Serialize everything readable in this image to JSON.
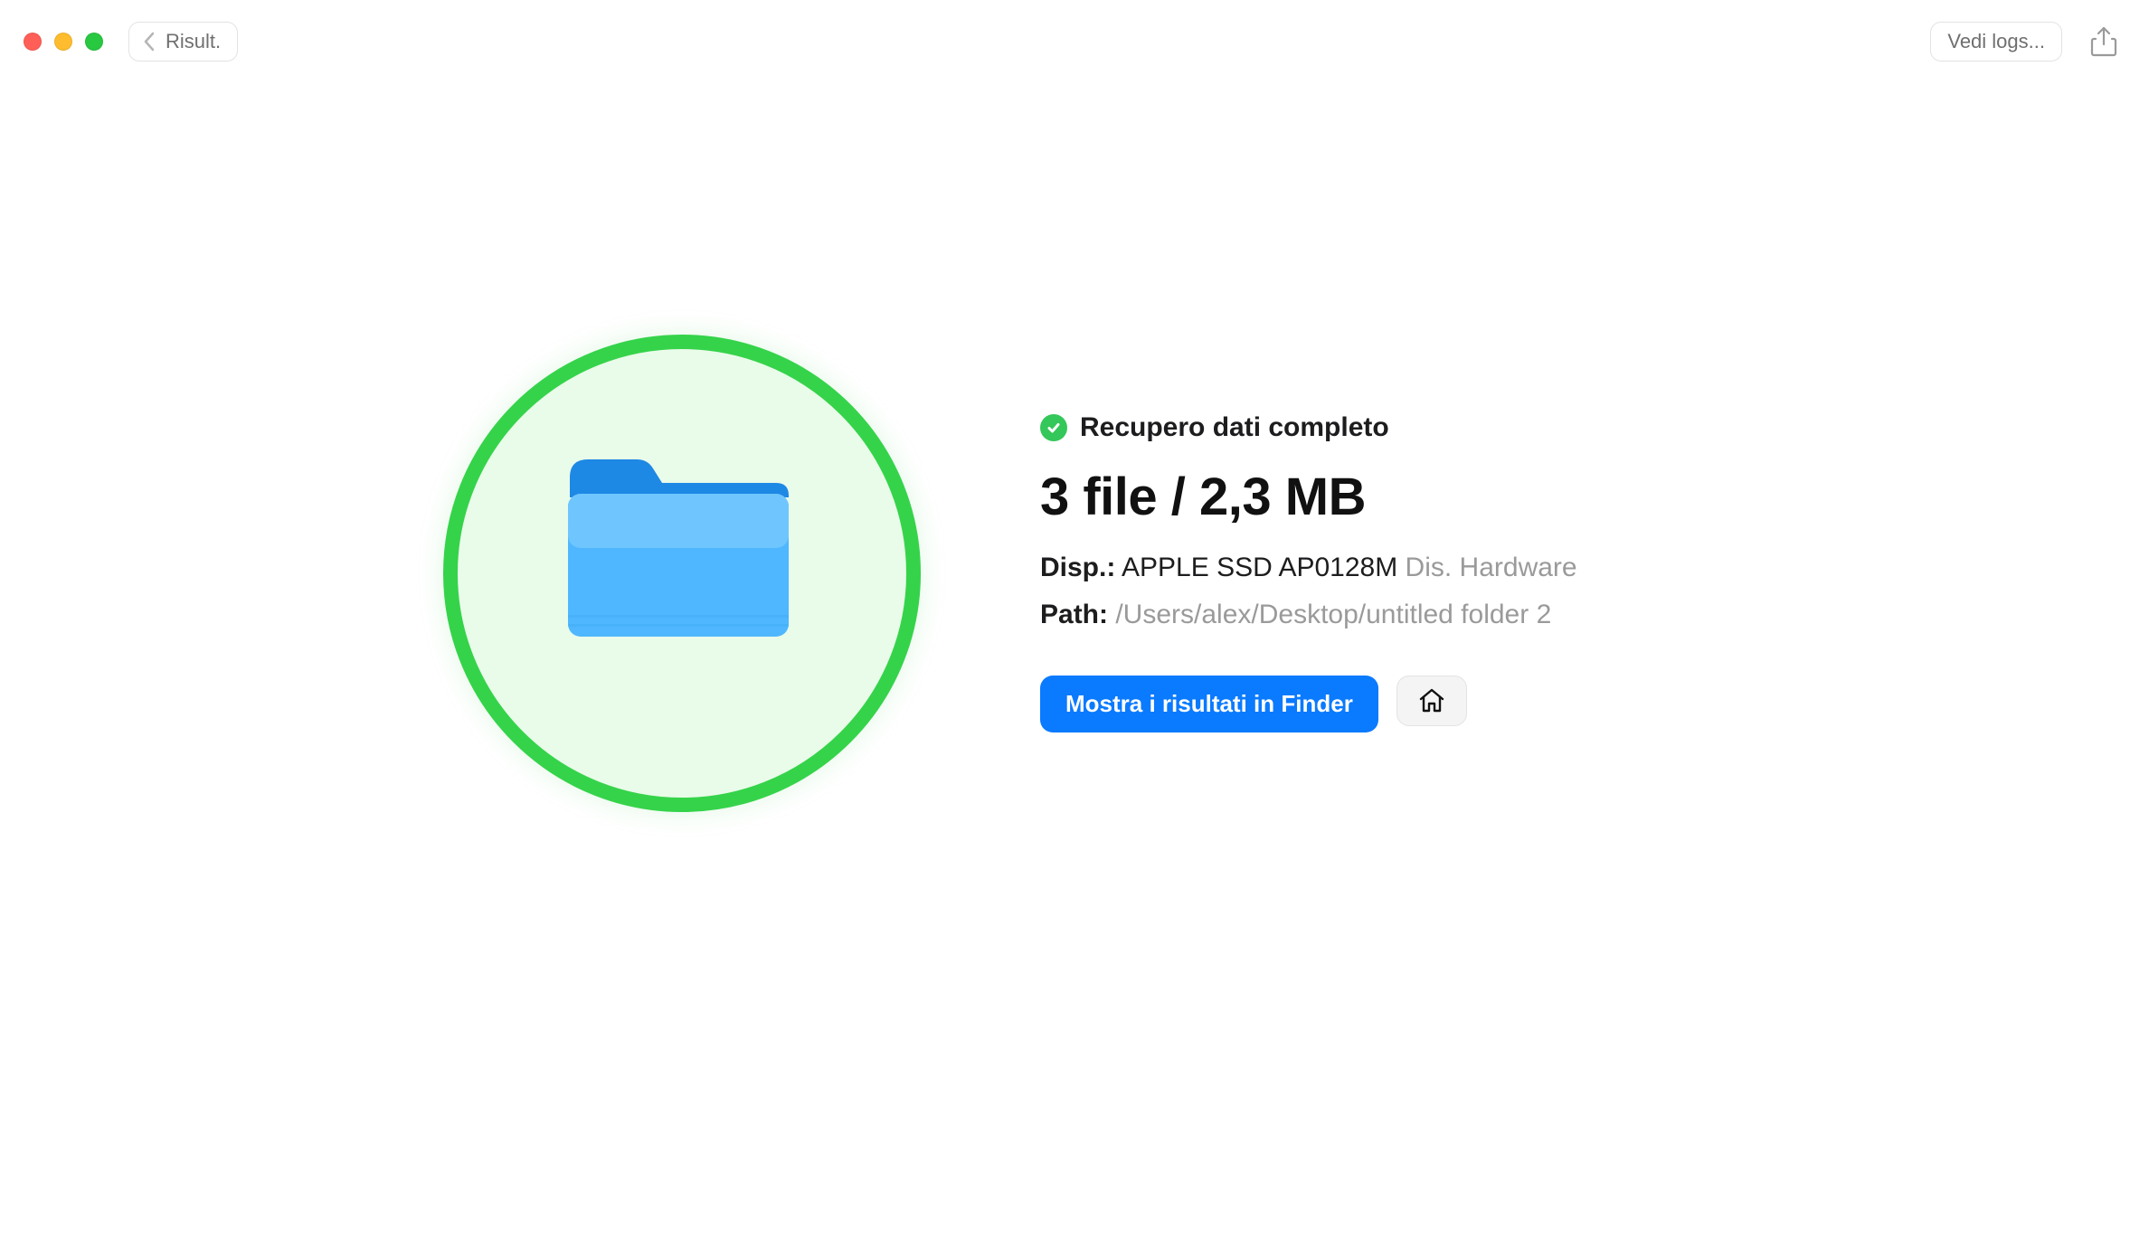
{
  "toolbar": {
    "back_label": "Risult.",
    "logs_label": "Vedi logs..."
  },
  "status": {
    "title": "Recupero dati completo",
    "file_count_text": "3 file",
    "file_size_text": "2,3 MB"
  },
  "details": {
    "device_label": "Disp.:",
    "device_value": "APPLE SSD AP0128M",
    "device_suffix": "Dis. Hardware",
    "path_label": "Path:",
    "path_value": "/Users/alex/Desktop/untitled folder 2"
  },
  "actions": {
    "show_in_finder": "Mostra i risultati in Finder"
  },
  "colors": {
    "accent_blue": "#0a7aff",
    "ring_green": "#35d34a",
    "ring_fill": "#e9fbe9",
    "status_green": "#34c759"
  }
}
